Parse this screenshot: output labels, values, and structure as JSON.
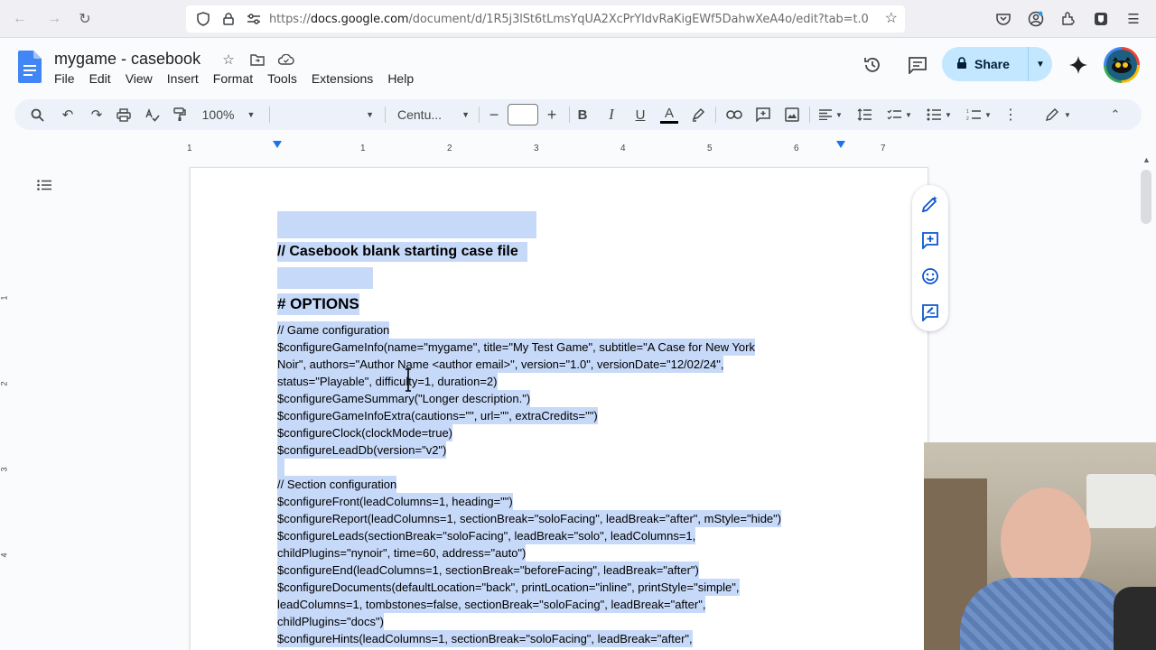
{
  "browser": {
    "url_prefix": "https://",
    "url_domain": "docs.google.com",
    "url_path": "/document/d/1R5j3lSt6tLmsYqUA2XcPrYldvRaKigEWf5DahwXeA4o/edit?tab=t.0"
  },
  "docs": {
    "title": "mygame - casebook",
    "menu": [
      "File",
      "Edit",
      "View",
      "Insert",
      "Format",
      "Tools",
      "Extensions",
      "Help"
    ],
    "share_label": "Share"
  },
  "toolbar": {
    "zoom": "100%",
    "style_value": "",
    "font_name": "Centu...",
    "font_size": ""
  },
  "ruler": {
    "labels": [
      "1",
      "1",
      "2",
      "3",
      "4",
      "5",
      "6",
      "7"
    ]
  },
  "document": {
    "heading_comment": "// Casebook blank starting case file",
    "heading_options": "# OPTIONS",
    "lines": [
      "// Game configuration",
      "$configureGameInfo(name=\"mygame\", title=\"My Test Game\", subtitle=\"A Case for New York",
      "Noir\", authors=\"Author Name <author email>\", version=\"1.0\", versionDate=\"12/02/24\",",
      "status=\"Playable\", difficulty=1, duration=2)",
      "$configureGameSummary(\"Longer description.\")",
      "$configureGameInfoExtra(cautions=\"\", url=\"\", extraCredits=\"\")",
      "$configureClock(clockMode=true)",
      "$configureLeadDb(version=\"v2\")",
      "",
      "// Section configuration",
      "$configureFront(leadColumns=1, heading=\"\")",
      "$configureReport(leadColumns=1, sectionBreak=\"soloFacing\", leadBreak=\"after\", mStyle=\"hide\")",
      "$configureLeads(sectionBreak=\"soloFacing\", leadBreak=\"solo\", leadColumns=1,",
      "childPlugins=\"nynoir\", time=60, address=\"auto\")",
      "$configureEnd(leadColumns=1, sectionBreak=\"beforeFacing\", leadBreak=\"after\")",
      "$configureDocuments(defaultLocation=\"back\", printLocation=\"inline\", printStyle=\"simple\",",
      "leadColumns=1, tombstones=false, sectionBreak=\"soloFacing\", leadBreak=\"after\",",
      "childPlugins=\"docs\")",
      "$configureHints(leadColumns=1, sectionBreak=\"soloFacing\", leadBreak=\"after\","
    ]
  },
  "colors": {
    "selection": "#c7d9f8",
    "share_bg": "#c2e7ff",
    "accent": "#0b57d0"
  }
}
